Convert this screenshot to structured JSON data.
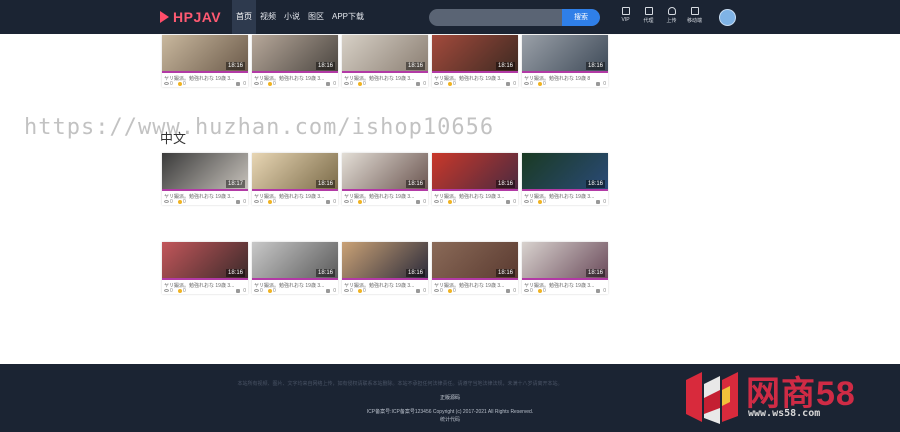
{
  "header": {
    "logo_text": "HPJAV",
    "nav": [
      "首页",
      "视频",
      "小说",
      "图区",
      "APP下载"
    ],
    "search_placeholder": "",
    "search_button": "搜索",
    "tools": [
      "VIP",
      "代理",
      "上传",
      "移动端"
    ]
  },
  "section_label": "中文",
  "watermark": "https://www.huzhan.com/ishop10656",
  "cards": [
    {
      "title": "ヤリ鍛派。勉強れおな 19歳 3...",
      "duration": "18:16",
      "views": "0",
      "coins": "0",
      "likes": "0",
      "c1": "#c9b89e",
      "c2": "#6b5a4a"
    },
    {
      "title": "ヤリ鍛派。勉強れおな 19歳 3...",
      "duration": "18:16",
      "views": "0",
      "coins": "0",
      "likes": "0",
      "c1": "#b7a89a",
      "c2": "#4a4540"
    },
    {
      "title": "ヤリ鍛派。勉強れおな 19歳 3...",
      "duration": "18:16",
      "views": "0",
      "coins": "0",
      "likes": "0",
      "c1": "#d7d0c6",
      "c2": "#8a7e72"
    },
    {
      "title": "ヤリ鍛派。勉強れおな 19歳 3...",
      "duration": "18:16",
      "views": "0",
      "coins": "0",
      "likes": "0",
      "c1": "#a34a3c",
      "c2": "#3d2a22"
    },
    {
      "title": "ヤリ鍛派。勉強れおな 19歳 8",
      "duration": "18:16",
      "views": "0",
      "coins": "0",
      "likes": "0",
      "c1": "#9aa0a8",
      "c2": "#3e4a58"
    },
    {
      "title": "ヤリ鍛派。勉強れおな 19歳 3...",
      "duration": "18:17",
      "views": "0",
      "coins": "0",
      "likes": "0",
      "c1": "#3a3a3a",
      "c2": "#c9c4bd"
    },
    {
      "title": "ヤリ鍛派。勉強れおな 19歳 3...",
      "duration": "18:16",
      "views": "0",
      "coins": "0",
      "likes": "0",
      "c1": "#e8d6b4",
      "c2": "#7a6a48"
    },
    {
      "title": "ヤリ鍛派。勉強れおな 19歳 3...",
      "duration": "18:16",
      "views": "0",
      "coins": "0",
      "likes": "0",
      "c1": "#e3ded6",
      "c2": "#6b5550"
    },
    {
      "title": "ヤリ鍛派。勉強れおな 19歳 3...",
      "duration": "18:16",
      "views": "0",
      "coins": "0",
      "likes": "0",
      "c1": "#c9382a",
      "c2": "#4a2a40"
    },
    {
      "title": "ヤリ鍛派。勉強れおな 19歳 3...",
      "duration": "18:16",
      "views": "0",
      "coins": "0",
      "likes": "0",
      "c1": "#1a3a22",
      "c2": "#2a4a78"
    },
    {
      "title": "ヤリ鍛派。勉強れおな 19歳 3...",
      "duration": "18:16",
      "views": "0",
      "coins": "0",
      "likes": "0",
      "c1": "#c2565a",
      "c2": "#3a2a2a"
    },
    {
      "title": "ヤリ鍛派。勉強れおな 19歳 3...",
      "duration": "18:16",
      "views": "0",
      "coins": "0",
      "likes": "0",
      "c1": "#c8c8c8",
      "c2": "#5a5a5a"
    },
    {
      "title": "ヤリ鍛派。勉強れおな 19歳 3...",
      "duration": "18:16",
      "views": "0",
      "coins": "0",
      "likes": "0",
      "c1": "#caa276",
      "c2": "#2a2a3a"
    },
    {
      "title": "ヤリ鍛派。勉強れおな 19歳 3...",
      "duration": "18:16",
      "views": "0",
      "coins": "0",
      "likes": "0",
      "c1": "#8a6a58",
      "c2": "#5a3a30"
    },
    {
      "title": "ヤリ鍛派。勉強れおな 19歳 3...",
      "duration": "18:16",
      "views": "0",
      "coins": "0",
      "likes": "0",
      "c1": "#d8d2ce",
      "c2": "#6a4a5a"
    }
  ],
  "footer": {
    "notice": "本站所有视频、图片、文字均来自网络上传，如有侵权请联系本站删除。本站不承担任何法律责任。请遵守当地法律法规，未满十八岁请离开本站。",
    "source_link": "正版源码",
    "icp": "ICP备案号:ICP备案号123456   Copyright (c) 2017-2021 All Rights Reserved.",
    "stat": "统计代码"
  },
  "brand": {
    "name": "网商58",
    "url": "www.ws58.com"
  }
}
